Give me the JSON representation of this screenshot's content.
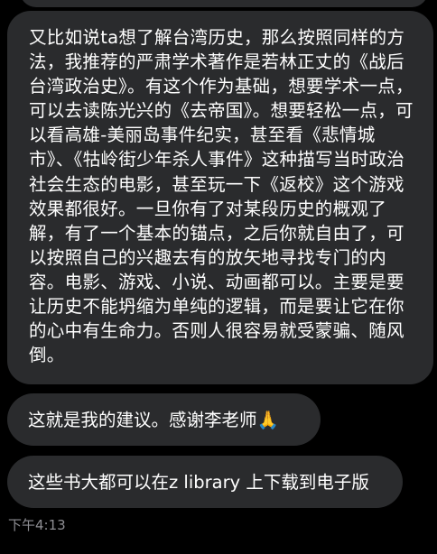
{
  "conversation": {
    "messages": [
      {
        "text": "又比如说ta想了解台湾历史，那么按照同样的方法，我推荐的严肃学术著作是若林正丈的《战后台湾政治史》。有这个作为基础，想要学术一点，可以去读陈光兴的《去帝国》。想要轻松一点，可以看高雄-美丽岛事件纪实，甚至看《悲情城市》、《牯岭街少年杀人事件》这种描写当时政治社会生态的电影，甚至玩一下《返校》这个游戏效果都很好。一旦你有了对某段历史的概观了解，有了一个基本的锚点，之后你就自由了，可以按照自己的兴趣去有的放矢地寻找专门的内容。电影、游戏、小说、动画都可以。主要是要让历史不能坍缩为单纯的逻辑，而是要让它在你的心中有生命力。否则人很容易就受蒙骗、随风倒。"
      },
      {
        "text": "这就是我的建议。感谢李老师🙏"
      },
      {
        "text": "这些书大都可以在z library 上下载到电子版"
      }
    ],
    "timestamp": "下午4:13"
  },
  "colors": {
    "background": "#000000",
    "bubble": "#2a2b2d",
    "text": "#ffffff",
    "timestamp": "#8e8e93"
  }
}
